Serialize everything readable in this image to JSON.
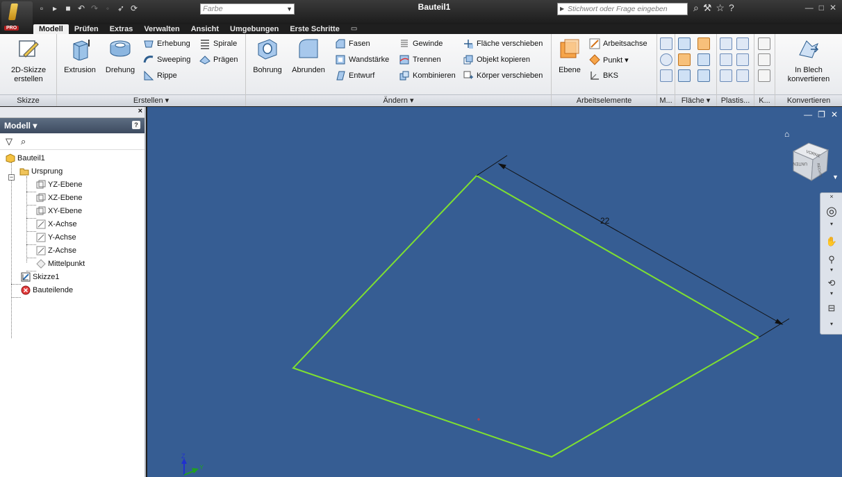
{
  "titlebar": {
    "doc_title": "Bauteil1",
    "color_placeholder": "Farbe",
    "search_placeholder": "Stichwort oder Frage eingeben",
    "pro_badge": "PRO"
  },
  "tabs": [
    {
      "label": "Modell",
      "active": true
    },
    {
      "label": "Prüfen"
    },
    {
      "label": "Extras"
    },
    {
      "label": "Verwalten"
    },
    {
      "label": "Ansicht"
    },
    {
      "label": "Umgebungen"
    },
    {
      "label": "Erste Schritte"
    }
  ],
  "ribbon": {
    "skizze": {
      "title": "Skizze",
      "sketch_btn": "2D-Skizze",
      "sketch_btn2": "erstellen"
    },
    "erstellen": {
      "title": "Erstellen ▾",
      "extrusion": "Extrusion",
      "drehung": "Drehung",
      "erhebung": "Erhebung",
      "sweeping": "Sweeping",
      "rippe": "Rippe",
      "spirale": "Spirale",
      "praegen": "Prägen"
    },
    "aendern": {
      "title": "Ändern ▾",
      "bohrung": "Bohrung",
      "abrunden": "Abrunden",
      "fasen": "Fasen",
      "wandstaerke": "Wandstärke",
      "entwurf": "Entwurf",
      "gewinde": "Gewinde",
      "trennen": "Trennen",
      "kombinieren": "Kombinieren",
      "flaeche_verschieben": "Fläche verschieben",
      "objekt_kopieren": "Objekt kopieren",
      "koerper_verschieben": "Körper verschieben"
    },
    "arbeitselemente": {
      "title": "Arbeitselemente",
      "ebene": "Ebene",
      "arbeitsachse": "Arbeitsachse",
      "punkt": "Punkt ▾",
      "bks": "BKS"
    },
    "small_panels": {
      "m": "M...",
      "flaeche": "Fläche ▾",
      "plastis": "Plastis...",
      "k": "K..."
    },
    "konvertieren": {
      "title": "Konvertieren",
      "btn1": "In Blech",
      "btn2": "konvertieren"
    }
  },
  "browser": {
    "header": "Modell ▾",
    "tree": [
      {
        "label": "Bauteil1",
        "icon": "part-icon"
      },
      {
        "label": "Ursprung",
        "icon": "folder-icon"
      },
      {
        "label": "YZ-Ebene",
        "icon": "plane-icon"
      },
      {
        "label": "XZ-Ebene",
        "icon": "plane-icon"
      },
      {
        "label": "XY-Ebene",
        "icon": "plane-icon"
      },
      {
        "label": "X-Achse",
        "icon": "axis-icon"
      },
      {
        "label": "Y-Achse",
        "icon": "axis-icon"
      },
      {
        "label": "Z-Achse",
        "icon": "axis-icon"
      },
      {
        "label": "Mittelpunkt",
        "icon": "point-icon"
      },
      {
        "label": "Skizze1",
        "icon": "sketch-icon"
      },
      {
        "label": "Bauteilende",
        "icon": "end-of-part-icon"
      }
    ]
  },
  "viewport": {
    "dimension_value": "22",
    "viewcube_face_front": "VORNE",
    "viewcube_face_bottom": "UNTEN",
    "viewcube_face_right": "RECHTS",
    "axis_z": "Z",
    "axis_y": "Y"
  },
  "colors": {
    "viewport_bg": "#365d93",
    "sketch_line": "#7fe030",
    "ribbon_bg": "#f0f1f3"
  }
}
